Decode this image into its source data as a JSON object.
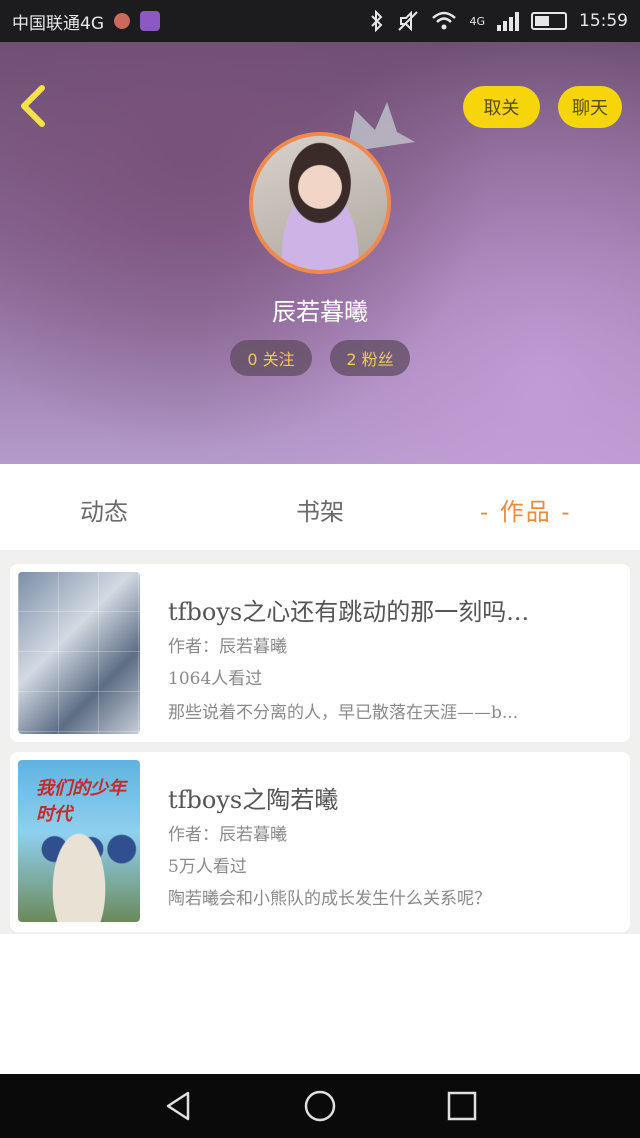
{
  "status_bar": {
    "carrier": "中国联通4G",
    "time": "15:59",
    "network_label": "4G"
  },
  "profile": {
    "username": "辰若暮曦",
    "following": "0 关注",
    "fans": "2 粉丝",
    "unfollow_label": "取关",
    "chat_label": "聊天"
  },
  "tabs": [
    {
      "label": "动态"
    },
    {
      "label": "书架"
    },
    {
      "label": "- 作品 -"
    }
  ],
  "works": [
    {
      "title": "tfboys之心还有跳动的那一刻吗...",
      "author": "作者：辰若暮曦",
      "views": "1064人看过",
      "description": "那些说着不分离的人，早已散落在天涯——b..."
    },
    {
      "title": "tfboys之陶若曦",
      "author": "作者：辰若暮曦",
      "views": "5万人看过",
      "description": "陶若曦会和小熊队的成长发生什么关系呢？",
      "cover_text": "我们的少年时代"
    }
  ],
  "colors": {
    "accent": "#f7d50b",
    "tab_active": "#f08a3c",
    "avatar_ring": "#ef8a4e"
  },
  "icons": {
    "back": "chevron-left-icon",
    "crown": "crown-icon",
    "nav_back": "triangle-back-icon",
    "nav_home": "circle-home-icon",
    "nav_recent": "square-recent-icon"
  }
}
